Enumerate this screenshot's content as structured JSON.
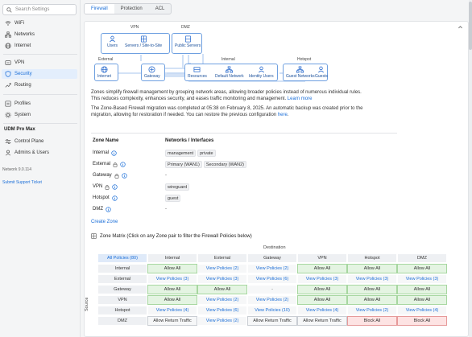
{
  "sidebar": {
    "search_placeholder": "Search Settings",
    "group1": [
      {
        "label": "WiFi",
        "icon": "wifi-icon"
      },
      {
        "label": "Networks",
        "icon": "networks-icon"
      },
      {
        "label": "Internet",
        "icon": "globe-icon"
      }
    ],
    "group2": [
      {
        "label": "VPN",
        "icon": "vpn-icon"
      },
      {
        "label": "Security",
        "icon": "shield-icon",
        "active": true
      },
      {
        "label": "Routing",
        "icon": "routing-icon"
      }
    ],
    "group3": [
      {
        "label": "Profiles",
        "icon": "profiles-icon"
      },
      {
        "label": "System",
        "icon": "gear-icon"
      }
    ],
    "device_name": "UDM Pro Max",
    "group4": [
      {
        "label": "Control Plane",
        "icon": "control-plane-icon"
      },
      {
        "label": "Admins & Users",
        "icon": "users-icon"
      }
    ],
    "version": "Network 9.0.114",
    "support_link": "Submit Support Ticket"
  },
  "tabs": [
    "Firewall",
    "Protection",
    "ACL"
  ],
  "diagram": {
    "vpn_label": "VPN",
    "dmz_label": "DMZ",
    "external_label": "External",
    "internal_label": "Internal",
    "hotspot_label": "Hotspot",
    "nodes": {
      "users": "Users",
      "servers_s2s": "Servers / Site-to-Site",
      "public_servers": "Public Servers",
      "internet": "Internet",
      "gateway": "Gateway",
      "resources": "Resources",
      "default_network": "Default Network",
      "identity_users": "Identity Users",
      "guest_networks": "Guest Networks",
      "guests": "Guests"
    }
  },
  "intro": {
    "line1": "Zones simplify firewall management by grouping network areas, allowing broader policies instead of numerous individual rules.",
    "line2": "This reduces complexity, enhances security, and eases traffic monitoring and management.",
    "learn_more": "Learn more",
    "migration1": "The Zone-Based Firewall migration was completed at 05:38 on February 8, 2025. An automatic backup was created prior to the",
    "migration2": "migration, allowing for restoration if needed. You can restore the previous configuration",
    "here": "here",
    "period": "."
  },
  "zones": {
    "col_zone": "Zone Name",
    "col_networks": "Networks / Interfaces",
    "rows": [
      {
        "name": "Internal",
        "lock": false,
        "tags": [
          "management",
          "private"
        ]
      },
      {
        "name": "External",
        "lock": true,
        "tags": [
          "Primary (WAN1)",
          "Secondary (WAN2)"
        ]
      },
      {
        "name": "Gateway",
        "lock": true,
        "tags": [],
        "dash": "-"
      },
      {
        "name": "VPN",
        "lock": true,
        "tags": [
          "wireguard"
        ]
      },
      {
        "name": "Hotspot",
        "lock": false,
        "tags": [
          "guest"
        ]
      },
      {
        "name": "DMZ",
        "lock": false,
        "tags": [],
        "dash": "-"
      }
    ],
    "create": "Create Zone"
  },
  "matrix": {
    "title": "Zone Matrix (Click on any Zone pair to filter the Firewall Policies below)",
    "destination": "Destination",
    "source": "Source",
    "all_policies": "All Policies (80)",
    "columns": [
      "Internal",
      "External",
      "Gateway",
      "VPN",
      "Hotspot",
      "DMZ"
    ],
    "rows": [
      {
        "label": "Internal",
        "cells": [
          [
            "allow",
            "Allow All"
          ],
          [
            "view",
            "View Policies (2)"
          ],
          [
            "view",
            "View Policies (2)"
          ],
          [
            "allow",
            "Allow All"
          ],
          [
            "allow",
            "Allow All"
          ],
          [
            "allow",
            "Allow All"
          ]
        ]
      },
      {
        "label": "External",
        "cells": [
          [
            "view",
            "View Policies (3)"
          ],
          [
            "view",
            "View Policies (3)"
          ],
          [
            "view",
            "View Policies (6)"
          ],
          [
            "view",
            "View Policies (3)"
          ],
          [
            "view",
            "View Policies (3)"
          ],
          [
            "view",
            "View Policies (3)"
          ]
        ]
      },
      {
        "label": "Gateway",
        "cells": [
          [
            "allow",
            "Allow All"
          ],
          [
            "allow",
            "Allow All"
          ],
          [
            "dash",
            "-"
          ],
          [
            "allow",
            "Allow All"
          ],
          [
            "allow",
            "Allow All"
          ],
          [
            "allow",
            "Allow All"
          ]
        ]
      },
      {
        "label": "VPN",
        "cells": [
          [
            "allow",
            "Allow All"
          ],
          [
            "view",
            "View Policies (2)"
          ],
          [
            "view",
            "View Policies (2)"
          ],
          [
            "allow",
            "Allow All"
          ],
          [
            "allow",
            "Allow All"
          ],
          [
            "allow",
            "Allow All"
          ]
        ]
      },
      {
        "label": "Hotspot",
        "cells": [
          [
            "view",
            "View Policies (4)"
          ],
          [
            "view",
            "View Policies (6)"
          ],
          [
            "view",
            "View Policies (10)"
          ],
          [
            "view",
            "View Policies (4)"
          ],
          [
            "view",
            "View Policies (2)"
          ],
          [
            "view",
            "View Policies (4)"
          ]
        ]
      },
      {
        "label": "DMZ",
        "cells": [
          [
            "ret",
            "Allow Return Traffic"
          ],
          [
            "view",
            "View Policies (2)"
          ],
          [
            "ret",
            "Allow Return Traffic"
          ],
          [
            "ret",
            "Allow Return Traffic"
          ],
          [
            "block",
            "Block All"
          ],
          [
            "block",
            "Block All"
          ]
        ]
      }
    ]
  },
  "colors": {
    "accent": "#1a6ed8",
    "allow": "#e4f4e2",
    "block": "#fde3e3"
  }
}
